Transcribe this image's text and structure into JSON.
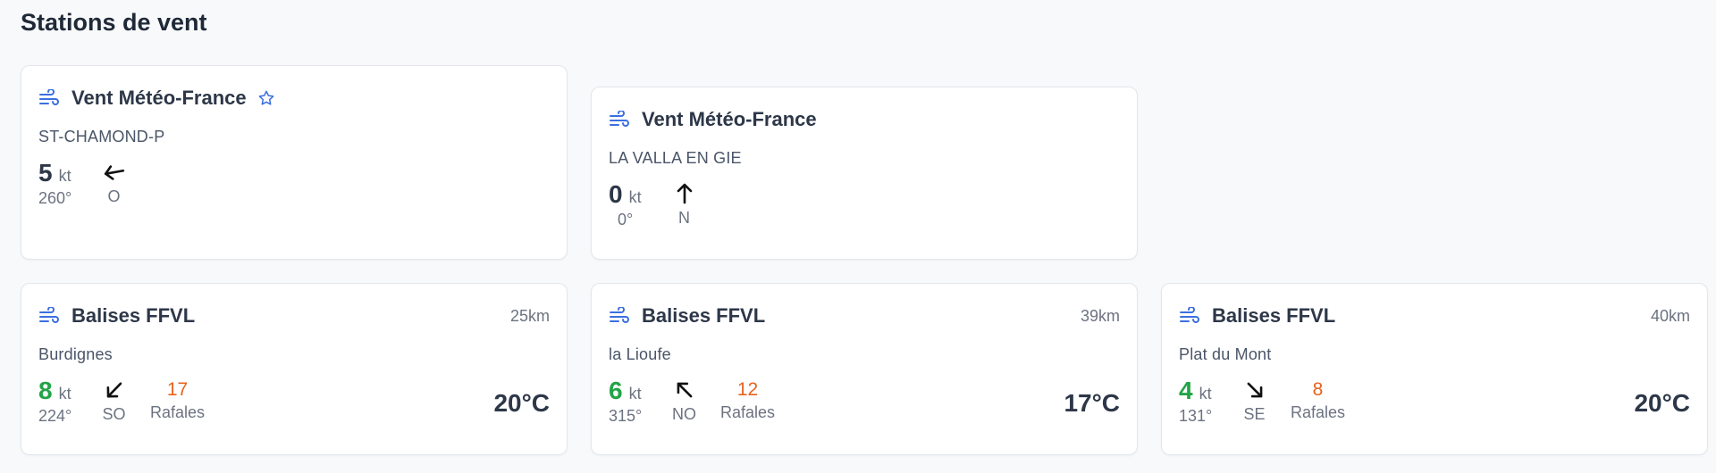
{
  "page": {
    "title": "Stations de vent"
  },
  "icons": {
    "wind": "wind-icon",
    "favorite": "star-outline-icon",
    "direction": "arrow-icon"
  },
  "colors": {
    "accent": "#3b6fe0",
    "calm_speed": "#22a447",
    "gust": "#e8621c"
  },
  "stations": [
    {
      "title": "Vent Météo-France",
      "favorite": true,
      "name": "ST-CHAMOND-P",
      "speed": "5",
      "speed_unit": "kt",
      "speed_color": "default",
      "degrees": "260°",
      "direction": "O",
      "arrow_rotation": 80
    },
    {
      "title": "Vent Météo-France",
      "name": "LA VALLA EN GIE",
      "speed": "0",
      "speed_unit": "kt",
      "speed_color": "default",
      "degrees": "0°",
      "direction": "N",
      "arrow_rotation": 180
    },
    {
      "title": "Balises FFVL",
      "distance": "25km",
      "name": "Burdignes",
      "speed": "8",
      "speed_unit": "kt",
      "speed_color": "green",
      "degrees": "224°",
      "direction": "SO",
      "arrow_rotation": 44,
      "gust": "17",
      "gust_label": "Rafales",
      "temperature": "20°C"
    },
    {
      "title": "Balises FFVL",
      "distance": "39km",
      "name": "la Lioufe",
      "speed": "6",
      "speed_unit": "kt",
      "speed_color": "green",
      "degrees": "315°",
      "direction": "NO",
      "arrow_rotation": 135,
      "gust": "12",
      "gust_label": "Rafales",
      "temperature": "17°C"
    },
    {
      "title": "Balises FFVL",
      "distance": "40km",
      "name": "Plat du Mont",
      "speed": "4",
      "speed_unit": "kt",
      "speed_color": "green",
      "degrees": "131°",
      "direction": "SE",
      "arrow_rotation": -45,
      "gust": "8",
      "gust_label": "Rafales",
      "temperature": "20°C"
    }
  ]
}
